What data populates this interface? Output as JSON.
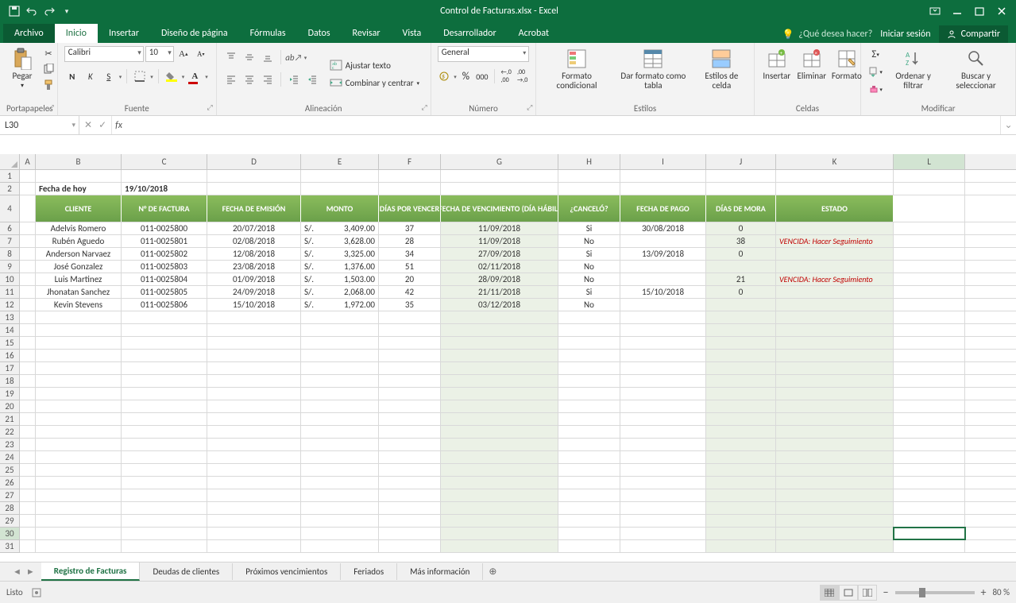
{
  "title": "Control de Facturas.xlsx - Excel",
  "tabs": {
    "file": "Archivo",
    "home": "Inicio",
    "insert": "Insertar",
    "layout": "Diseño de página",
    "formulas": "Fórmulas",
    "data": "Datos",
    "review": "Revisar",
    "view": "Vista",
    "developer": "Desarrollador",
    "acrobat": "Acrobat",
    "tellme": "¿Qué desea hacer?",
    "signin": "Iniciar sesión",
    "share": "Compartir"
  },
  "ribbon": {
    "paste": "Pegar",
    "clipboard": "Portapapeles",
    "font_name": "Calibri",
    "font_size": "10",
    "font": "Fuente",
    "alignment": "Alineación",
    "wrap": "Ajustar texto",
    "merge": "Combinar y centrar",
    "number_format": "General",
    "number": "Número",
    "cond_format": "Formato condicional",
    "format_table": "Dar formato como tabla",
    "cell_styles": "Estilos de celda",
    "styles": "Estilos",
    "insert_btn": "Insertar",
    "delete_btn": "Eliminar",
    "format_btn": "Formato",
    "cells": "Celdas",
    "sort": "Ordenar y filtrar",
    "find": "Buscar y seleccionar",
    "editing": "Modificar"
  },
  "namebox": "L30",
  "columns": [
    "A",
    "B",
    "C",
    "D",
    "E",
    "F",
    "G",
    "H",
    "I",
    "J",
    "K",
    "L"
  ],
  "meta": {
    "today_label": "Fecha de hoy",
    "today_value": "19/10/2018"
  },
  "headers": [
    "CLIENTE",
    "N° DE FACTURA",
    "FECHA DE EMISIÓN",
    "MONTO",
    "DÍAS POR VENCER",
    "FECHA DE VENCIMIENTO (DÍA HÁBIL)",
    "¿CANCELÓ?",
    "FECHA DE PAGO",
    "DÍAS DE MORA",
    "ESTADO"
  ],
  "rows": [
    {
      "r": "6",
      "cliente": "Adelvis Romero",
      "num": "011-0025800",
      "emision": "20/07/2018",
      "curr": "S/.",
      "monto": "3,409.00",
      "dias": "37",
      "venc": "11/09/2018",
      "cancelo": "Si",
      "pago": "30/08/2018",
      "mora": "0",
      "estado": ""
    },
    {
      "r": "7",
      "cliente": "Rubén Aguedo",
      "num": "011-0025801",
      "emision": "02/08/2018",
      "curr": "S/.",
      "monto": "3,628.00",
      "dias": "28",
      "venc": "11/09/2018",
      "cancelo": "No",
      "pago": "",
      "mora": "38",
      "estado": "VENCIDA: Hacer Seguimiento"
    },
    {
      "r": "8",
      "cliente": "Anderson Narvaez",
      "num": "011-0025802",
      "emision": "12/08/2018",
      "curr": "S/.",
      "monto": "3,325.00",
      "dias": "34",
      "venc": "27/09/2018",
      "cancelo": "Si",
      "pago": "13/09/2018",
      "mora": "0",
      "estado": ""
    },
    {
      "r": "9",
      "cliente": "José Gonzalez",
      "num": "011-0025803",
      "emision": "23/08/2018",
      "curr": "S/.",
      "monto": "1,376.00",
      "dias": "51",
      "venc": "02/11/2018",
      "cancelo": "No",
      "pago": "",
      "mora": "",
      "estado": ""
    },
    {
      "r": "10",
      "cliente": "Luis Martinez",
      "num": "011-0025804",
      "emision": "01/09/2018",
      "curr": "S/.",
      "monto": "1,503.00",
      "dias": "20",
      "venc": "28/09/2018",
      "cancelo": "No",
      "pago": "",
      "mora": "21",
      "estado": "VENCIDA: Hacer Seguimiento"
    },
    {
      "r": "11",
      "cliente": "Jhonatan Sanchez",
      "num": "011-0025805",
      "emision": "24/09/2018",
      "curr": "S/.",
      "monto": "2,068.00",
      "dias": "42",
      "venc": "21/11/2018",
      "cancelo": "Si",
      "pago": "15/10/2018",
      "mora": "0",
      "estado": ""
    },
    {
      "r": "12",
      "cliente": "Kevin Stevens",
      "num": "011-0025806",
      "emision": "15/10/2018",
      "curr": "S/.",
      "monto": "1,972.00",
      "dias": "35",
      "venc": "03/12/2018",
      "cancelo": "No",
      "pago": "",
      "mora": "",
      "estado": ""
    }
  ],
  "empty_rows": [
    "13",
    "14",
    "15",
    "16",
    "17",
    "18",
    "19",
    "20",
    "21",
    "22",
    "23",
    "24",
    "25",
    "26",
    "27",
    "28",
    "29",
    "30",
    "31"
  ],
  "sheets": {
    "s1": "Registro de Facturas",
    "s2": "Deudas de clientes",
    "s3": "Próximos vencimientos",
    "s4": "Feriados",
    "s5": "Más información"
  },
  "status": {
    "ready": "Listo",
    "zoom": "80 %"
  }
}
